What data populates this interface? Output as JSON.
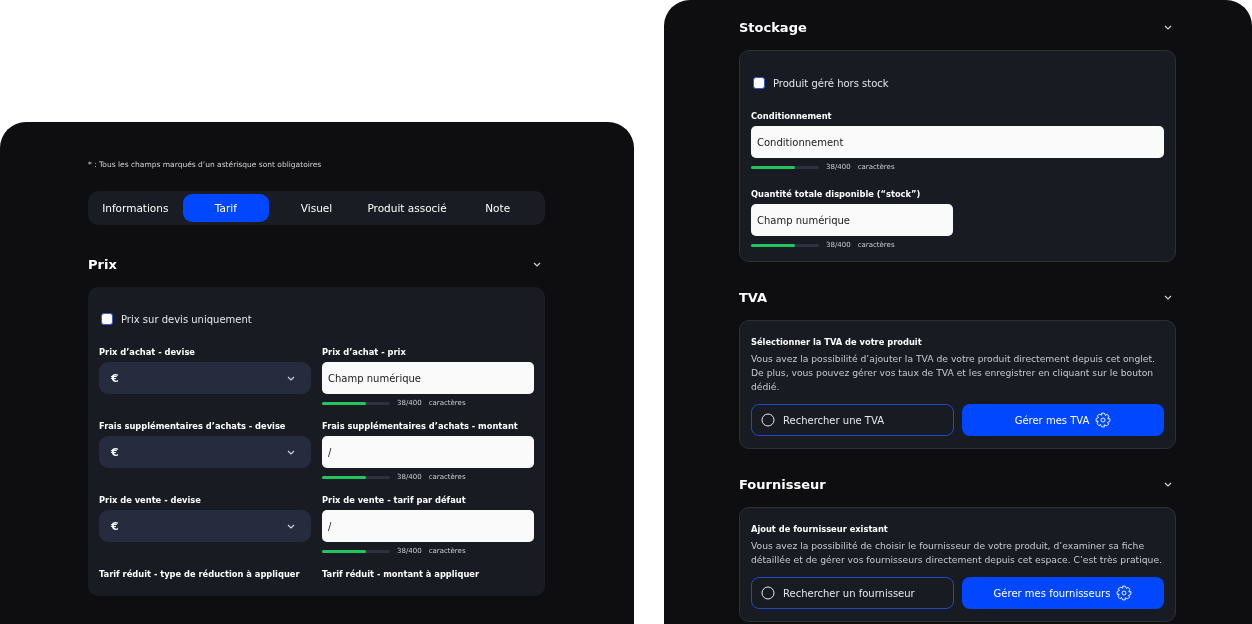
{
  "left": {
    "note": "* : Tous les champs marqués d’un astérisque sont obligatoires",
    "tabs": [
      {
        "label": "Informations",
        "selected": false
      },
      {
        "label": "Tarif",
        "selected": true
      },
      {
        "label": "Visuel",
        "selected": false
      },
      {
        "label": "Produit associé",
        "selected": false
      },
      {
        "label": "Note",
        "selected": false
      }
    ],
    "sections": [
      {
        "title": "Prix",
        "kind": "grid",
        "checkbox": {
          "label": "Prix sur devis uniquement",
          "checked": false
        },
        "fields": [
          {
            "label": "Prix d’achat - devise",
            "kind": "select",
            "value": "€"
          },
          {
            "label": "Prix d’achat - prix",
            "kind": "text",
            "value": "Champ numérique",
            "counter": {
              "level": 0.65,
              "count": "38/400",
              "unit": "caractères"
            }
          },
          {
            "label": "Frais supplémentaires d’achats - devise",
            "kind": "select",
            "value": "€"
          },
          {
            "label": "Frais supplémentaires d’achats - montant",
            "kind": "text",
            "value": "/",
            "counter": {
              "level": 0.65,
              "count": "38/400",
              "unit": "caractères"
            }
          },
          {
            "label": "Prix de vente - devise",
            "kind": "select",
            "value": "€"
          },
          {
            "label": "Prix de vente - tarif par défaut",
            "kind": "text",
            "value": "/",
            "counter": {
              "level": 0.65,
              "count": "38/400",
              "unit": "caractères"
            }
          },
          {
            "label": "Tarif réduit - type de réduction à appliquer",
            "kind": "label"
          },
          {
            "label": "Tarif réduit - montant à appliquer",
            "kind": "label"
          }
        ]
      }
    ]
  },
  "right": {
    "sections": [
      {
        "title": "Stockage",
        "kind": "stack",
        "checkbox": {
          "label": "Produit géré hors stock",
          "checked": false
        },
        "fields": [
          {
            "label": "Conditionnement",
            "kind": "text",
            "wide": true,
            "value": "Conditionnement",
            "counter": {
              "level": 0.65,
              "count": "38/400",
              "unit": "caractères"
            }
          },
          {
            "label": "Quantité totale disponible (“stock”)",
            "kind": "text",
            "wide": false,
            "value": "Champ numérique",
            "counter": {
              "level": 0.65,
              "count": "38/400",
              "unit": "caractères"
            }
          }
        ]
      },
      {
        "title": "TVA",
        "kind": "info",
        "heading": "Sélectionner la TVA de votre produit",
        "description": "Vous avez la possibilité d’ajouter la TVA de votre produit directement depuis cet onglet. De plus, vous pouvez gérer vos taux de TVA et les enregistrer en cliquant sur le bouton dédié.",
        "search": {
          "placeholder": "Rechercher une TVA"
        },
        "button": "Gérer mes TVA"
      },
      {
        "title": "Fournisseur",
        "kind": "info",
        "heading": "Ajout de fournisseur existant",
        "description": "Vous avez la possibilité de choisir le fournisseur de votre produit, d’examiner sa fiche détaillée et de gérer vos fournisseurs directement depuis cet espace. C’est très pratique.",
        "search": {
          "placeholder": "Rechercher un fournisseur"
        },
        "button": "Gérer mes fournisseurs"
      }
    ]
  }
}
